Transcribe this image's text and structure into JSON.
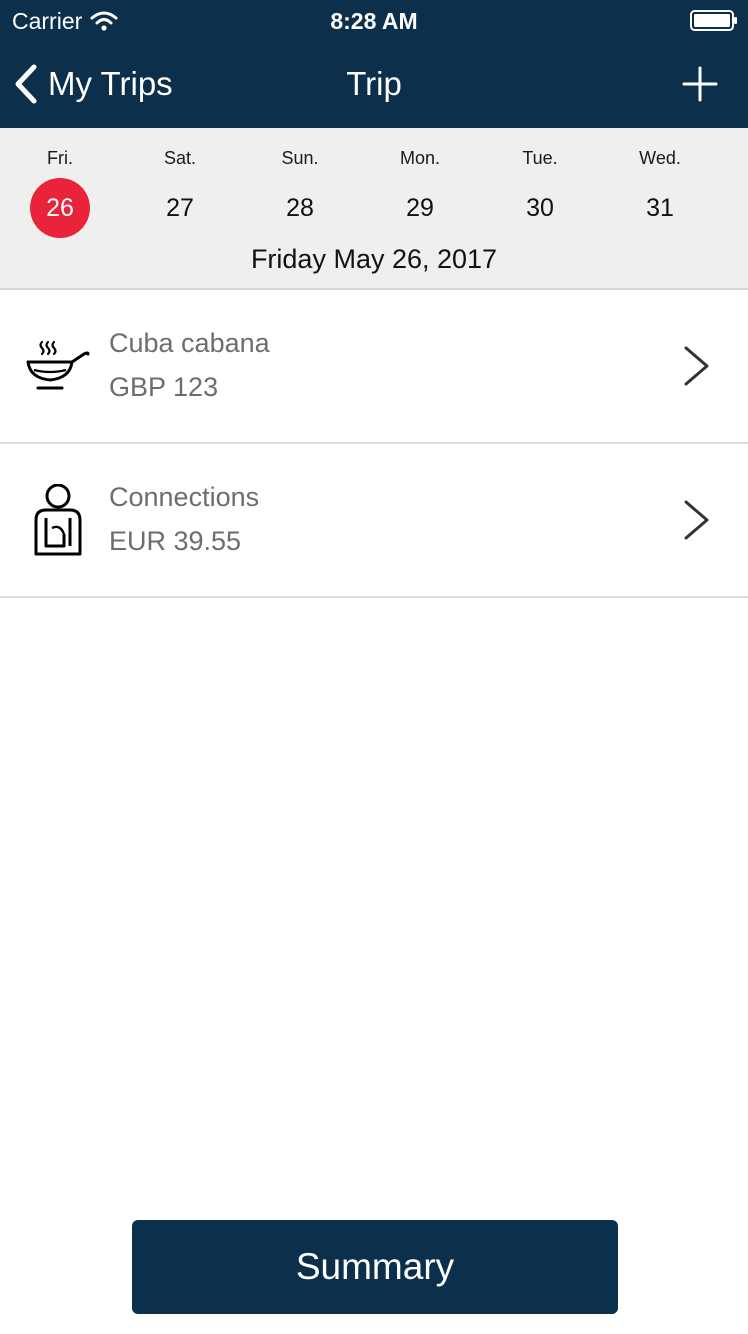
{
  "status_bar": {
    "carrier": "Carrier",
    "time": "8:28 AM"
  },
  "nav": {
    "back_label": "My Trips",
    "title": "Trip",
    "add_icon": "plus-icon"
  },
  "week": {
    "days": [
      {
        "label": "Fri.",
        "num": "26",
        "selected": true
      },
      {
        "label": "Sat.",
        "num": "27",
        "selected": false
      },
      {
        "label": "Sun.",
        "num": "28",
        "selected": false
      },
      {
        "label": "Mon.",
        "num": "29",
        "selected": false
      },
      {
        "label": "Tue.",
        "num": "30",
        "selected": false
      },
      {
        "label": "Wed.",
        "num": "31",
        "selected": false
      }
    ],
    "selected_date": "Friday May 26, 2017"
  },
  "expenses": [
    {
      "title": "Cuba cabana",
      "amount": "GBP 123",
      "icon": "soup-bowl-icon"
    },
    {
      "title": "Connections",
      "amount": "EUR 39.55",
      "icon": "person-icon"
    }
  ],
  "summary_label": "Summary",
  "colors": {
    "nav_background": "#0c2f4b",
    "selected_day": "#e8233a",
    "week_background": "#efefef",
    "secondary_text": "#6d6d6d"
  }
}
